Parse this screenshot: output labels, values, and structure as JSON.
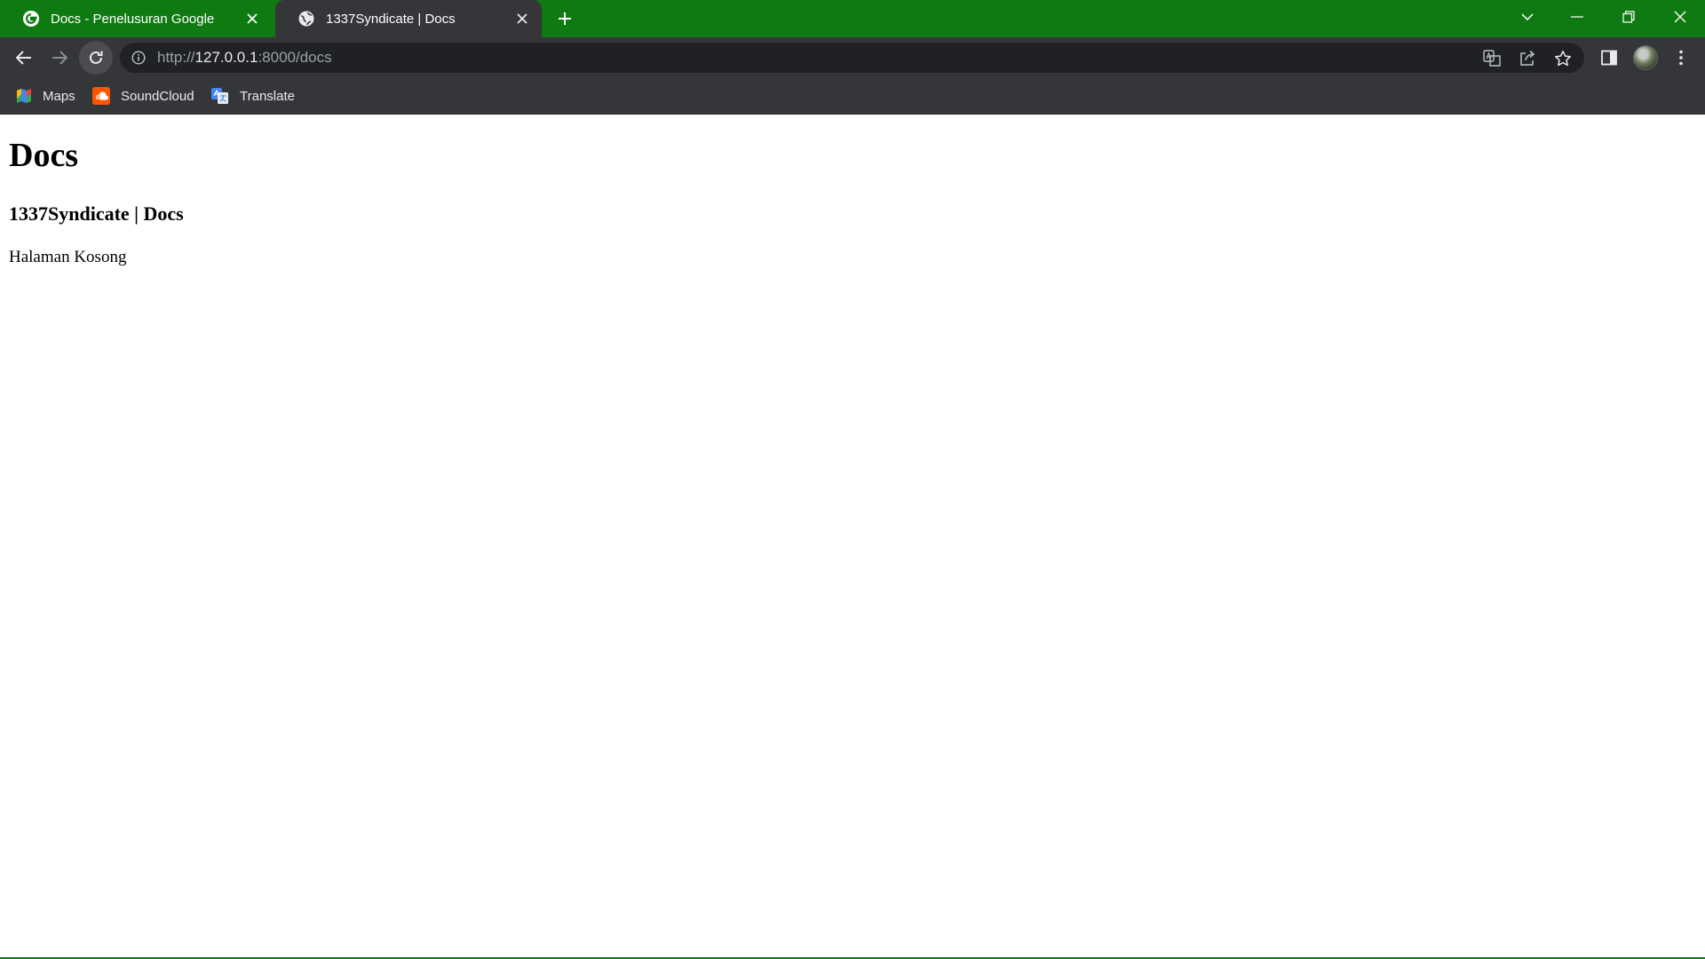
{
  "browser": {
    "frame_color": "#107a12",
    "toolbar_color": "#35363a",
    "tabs": [
      {
        "title": "Docs - Penelusuran Google",
        "favicon": "google-g-icon",
        "active": false
      },
      {
        "title": "1337Syndicate | Docs",
        "favicon": "globe-icon",
        "active": true
      }
    ],
    "address_bar": {
      "scheme": "http://",
      "host": "127.0.0.1",
      "rest": ":8000/docs"
    },
    "bookmarks": [
      {
        "label": "Maps",
        "icon": "maps-icon"
      },
      {
        "label": "SoundCloud",
        "icon": "soundcloud-icon"
      },
      {
        "label": "Translate",
        "icon": "translate-icon"
      }
    ]
  },
  "page": {
    "heading": "Docs",
    "subheading": "1337Syndicate | Docs",
    "body_text": "Halaman Kosong"
  }
}
